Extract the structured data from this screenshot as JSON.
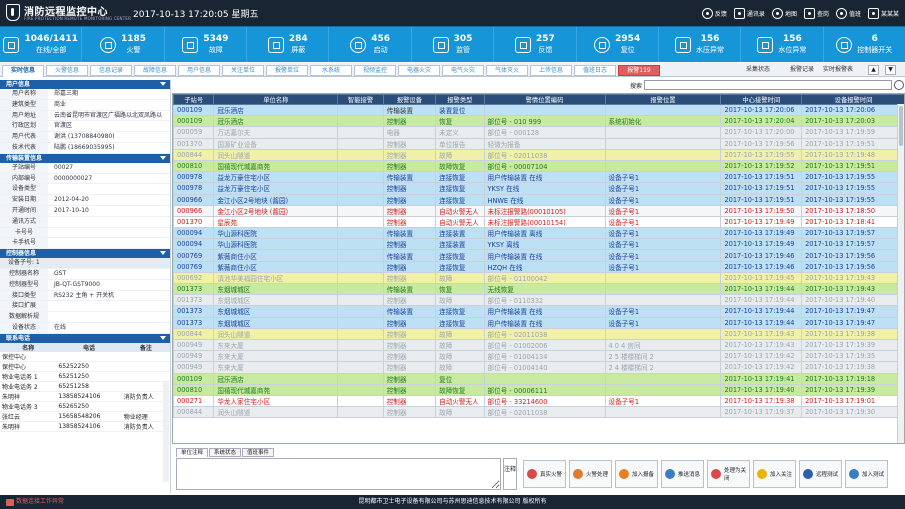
{
  "header": {
    "title": "消防远程监控中心",
    "subtitle": "FIRE PROTECTION REMOTE MONITORING CENTER",
    "datetime": "2017-10-13  17:20:05  星期五",
    "tools": [
      {
        "label": "反馈",
        "icon": "feedback-icon"
      },
      {
        "label": "通讯录",
        "icon": "contacts-icon"
      },
      {
        "label": "地图",
        "icon": "map-icon"
      },
      {
        "label": "查岗",
        "icon": "patrol-icon"
      },
      {
        "label": "值班",
        "icon": "duty-icon"
      },
      {
        "label": "某某某",
        "icon": "user-icon"
      }
    ]
  },
  "stats": [
    {
      "value": "1046/1411",
      "label": "在线/全部",
      "icon": "online-icon"
    },
    {
      "value": "1185",
      "label": "火警",
      "icon": "fire-alarm-icon"
    },
    {
      "value": "5349",
      "label": "故障",
      "icon": "fault-icon"
    },
    {
      "value": "284",
      "label": "屏蔽",
      "icon": "shield-icon"
    },
    {
      "value": "456",
      "label": "启动",
      "icon": "start-icon"
    },
    {
      "value": "305",
      "label": "监管",
      "icon": "supervise-icon"
    },
    {
      "value": "257",
      "label": "反馈",
      "icon": "feedback-stat-icon"
    },
    {
      "value": "2954",
      "label": "复位",
      "icon": "reset-icon"
    },
    {
      "value": "156",
      "label": "水压异常",
      "icon": "water-pressure-icon"
    },
    {
      "value": "156",
      "label": "水位异常",
      "icon": "water-level-icon"
    },
    {
      "value": "6",
      "label": "控制器开关",
      "icon": "controller-switch-icon"
    }
  ],
  "tabs": [
    "实时信息",
    "火警信息",
    "信息记录",
    "故障信息",
    "用户信息",
    "关注单位",
    "报警单位",
    "水系统",
    "视频监控",
    "电器火灾",
    "电气火灾",
    "气体灭火",
    "上传信息",
    "值班日志",
    "报警119"
  ],
  "tab_tools": {
    "collect": "采集状态",
    "report": "报警记录",
    "realtime": "实时报警表"
  },
  "user_info": {
    "title": "用户信息",
    "rows": [
      {
        "k": "用户名称",
        "v": "郑嘉三期"
      },
      {
        "k": "建筑类型",
        "v": "商业"
      },
      {
        "k": "用户地址",
        "v": "云南省昆明市官渡区广福路以北双凤路以"
      },
      {
        "k": "行政区划",
        "v": "官渡区"
      },
      {
        "k": "用户代表",
        "v": "谢洪 (13708840980)"
      },
      {
        "k": "技术代表",
        "v": "陆鹏 (18669035995)"
      }
    ]
  },
  "device_info": {
    "title": "传输装置信息",
    "rows": [
      {
        "k": "子站编号",
        "v": "00027"
      },
      {
        "k": "内部编号",
        "v": "0000000027"
      },
      {
        "k": "设备类型",
        "v": ""
      },
      {
        "k": "安装日期",
        "v": "2012-04-20"
      },
      {
        "k": "开通时间",
        "v": "2017-10-10"
      },
      {
        "k": "通讯方式",
        "v": ""
      },
      {
        "k": "卡号号",
        "v": ""
      },
      {
        "k": "卡手机号",
        "v": ""
      }
    ]
  },
  "controller_info": {
    "title": "控制器信息",
    "sub": "设备子号: 1",
    "rows": [
      {
        "k": "控制器名称",
        "v": "GST"
      },
      {
        "k": "控制器型号",
        "v": "JB-QT-GST9000"
      },
      {
        "k": "接口类型",
        "v": "RS232 主角 + 开关机"
      },
      {
        "k": "接口扩展",
        "v": ""
      },
      {
        "k": "数据解析规",
        "v": ""
      },
      {
        "k": "设备状态",
        "v": "在线"
      }
    ]
  },
  "contacts": {
    "title": "联系电话",
    "headers": [
      "名称",
      "电话",
      "备注"
    ],
    "rows": [
      [
        "保控中心",
        "",
        ""
      ],
      [
        "保控中心",
        "65252250",
        ""
      ],
      [
        "物业电话务 1",
        "65251250",
        ""
      ],
      [
        "物业电话务 2",
        "65251258",
        ""
      ],
      [
        "朱明祥",
        "13858524106",
        "消防负责人"
      ],
      [
        "物业电话务 3",
        "65265250",
        ""
      ],
      [
        "张红云",
        "15658548206",
        "物业经理"
      ],
      [
        "朱明祥",
        "13858524106",
        "消防负责人"
      ]
    ]
  },
  "search": {
    "label": "搜索",
    "placeholder": ""
  },
  "table": {
    "headers": [
      "子站号",
      "单位名称",
      "智能接警",
      "报警设备",
      "报警类型",
      "警情位置编码",
      "报警位置",
      "中心接警时间",
      "设备报警时间"
    ],
    "rows": [
      {
        "s": "bl",
        "c": [
          "c-b",
          "c-b",
          "c-gy",
          "c-k",
          "c-b",
          "c-b",
          "c-b",
          "c-b",
          "c-b"
        ],
        "v": [
          "000109",
          "冠乐酒店",
          "",
          "传输装置",
          "装置复位",
          "",
          "",
          "2017-10-13 17:20:06",
          "2017-10-13 17:20:06"
        ]
      },
      {
        "s": "gr",
        "c": [
          "c-g",
          "c-g",
          "c-gy",
          "c-g",
          "c-g",
          "c-g",
          "c-g",
          "c-g",
          "c-g"
        ],
        "v": [
          "000109",
          "冠乐酒店",
          "",
          "控制器",
          "恢复",
          "部位号 - 010 999",
          "系统初始化",
          "2017-10-13 17:20:04",
          "2017-10-13 17:20:03"
        ]
      },
      {
        "s": "gy",
        "c": [
          "c-gy",
          "c-gy",
          "c-gy",
          "c-gy",
          "c-gy",
          "c-gy",
          "c-gy",
          "c-gy",
          "c-gy"
        ],
        "v": [
          "000059",
          "万达嘉尔夫",
          "",
          "电器",
          "未定义",
          "部位号 - 000128",
          "",
          "2017-10-13 17:20:00",
          "2017-10-13 17:19:59"
        ]
      },
      {
        "s": "gy",
        "c": [
          "c-gy",
          "c-gy",
          "c-gy",
          "c-gy",
          "c-gy",
          "c-gy",
          "c-gy",
          "c-gy",
          "c-gy"
        ],
        "v": [
          "001370",
          "国源矿业设备",
          "",
          "控制器",
          "单位报告",
          "轻微为报备",
          "",
          "2017-10-13 17:19:56",
          "2017-10-13 17:19:51"
        ]
      },
      {
        "s": "yl",
        "c": [
          "c-gy",
          "c-gy",
          "c-gy",
          "c-gy",
          "c-gy",
          "c-gy",
          "c-gy",
          "c-gy",
          "c-gy"
        ],
        "v": [
          "000844",
          "润头山隧道",
          "",
          "控制器",
          "故障",
          "部位号 - 02011038",
          "",
          "2017-10-13 17:19:55",
          "2017-10-13 17:19:48"
        ]
      },
      {
        "s": "gr",
        "c": [
          "c-g",
          "c-g",
          "c-gy",
          "c-g",
          "c-g",
          "c-g",
          "c-g",
          "c-g",
          "c-g"
        ],
        "v": [
          "000810",
          "国禧现代城嘉商苑",
          "",
          "控制器",
          "故障恢复",
          "部位号 - 00007104",
          "",
          "2017-10-13 17:19:52",
          "2017-10-13 17:19:51"
        ]
      },
      {
        "s": "bl",
        "c": [
          "c-b",
          "c-b",
          "c-gy",
          "c-b",
          "c-b",
          "c-b",
          "c-b",
          "c-b",
          "c-b"
        ],
        "v": [
          "000978",
          "益龙万豪住宅小区",
          "",
          "传输装置",
          "连接恢复",
          "用户传输装置 在线",
          "设备子号1",
          "2017-10-13 17:19:51",
          "2017-10-13 17:19:55"
        ]
      },
      {
        "s": "bl",
        "c": [
          "c-b",
          "c-b",
          "c-gy",
          "c-b",
          "c-b",
          "c-b",
          "c-b",
          "c-b",
          "c-b"
        ],
        "v": [
          "000978",
          "益龙万豪住宅小区",
          "",
          "控制器",
          "连接恢复",
          "YKSY 在线",
          "设备子号1",
          "2017-10-13 17:19:51",
          "2017-10-13 17:19:55"
        ]
      },
      {
        "s": "bl",
        "c": [
          "c-b",
          "c-b",
          "c-gy",
          "c-b",
          "c-b",
          "c-b",
          "c-b",
          "c-b",
          "c-b"
        ],
        "v": [
          "000966",
          "金江小区2号地块 (酱园)",
          "",
          "控制器",
          "连接恢复",
          "HNWE 在线",
          "设备子号1",
          "2017-10-13 17:19:51",
          "2017-10-13 17:19:55"
        ]
      },
      {
        "s": "",
        "c": [
          "c-r",
          "c-r",
          "c-gy",
          "c-r",
          "c-r",
          "c-r",
          "c-r",
          "c-r",
          "c-r"
        ],
        "v": [
          "000966",
          "金江小区2号地块 (酱园)",
          "",
          "控制器",
          "自动火警无人",
          "未标注报警路(00010105)",
          "设备子号1",
          "2017-10-13 17:19:50",
          "2017-10-13 17:18:50"
        ]
      },
      {
        "s": "",
        "c": [
          "c-r",
          "c-r",
          "c-gy",
          "c-r",
          "c-r",
          "c-r",
          "c-r",
          "c-r",
          "c-r"
        ],
        "v": [
          "001370",
          "星辰苑",
          "",
          "控制器",
          "自动火警无人",
          "未标注报警路(00010154)",
          "设备子号1",
          "2017-10-13 17:19:49",
          "2017-10-13 17:18:41"
        ]
      },
      {
        "s": "bl",
        "c": [
          "c-b",
          "c-b",
          "c-gy",
          "c-b",
          "c-b",
          "c-b",
          "c-b",
          "c-b",
          "c-b"
        ],
        "v": [
          "000094",
          "华山源科医院",
          "",
          "传输装置",
          "连接装置",
          "用户传输装置 离线",
          "设备子号1",
          "2017-10-13 17:19:49",
          "2017-10-13 17:19:57"
        ]
      },
      {
        "s": "bl",
        "c": [
          "c-b",
          "c-b",
          "c-gy",
          "c-b",
          "c-b",
          "c-b",
          "c-b",
          "c-b",
          "c-b"
        ],
        "v": [
          "000094",
          "华山源科医院",
          "",
          "控制器",
          "连接装置",
          "YKSY 离线",
          "设备子号1",
          "2017-10-13 17:19:49",
          "2017-10-13 17:19:57"
        ]
      },
      {
        "s": "bl",
        "c": [
          "c-b",
          "c-b",
          "c-gy",
          "c-b",
          "c-b",
          "c-b",
          "c-b",
          "c-b",
          "c-b"
        ],
        "v": [
          "000769",
          "紫薇商住小区",
          "",
          "传输装置",
          "连接恢复",
          "用户传输装置 在线",
          "设备子号1",
          "2017-10-13 17:19:46",
          "2017-10-13 17:19:56"
        ]
      },
      {
        "s": "bl",
        "c": [
          "c-b",
          "c-b",
          "c-gy",
          "c-b",
          "c-b",
          "c-b",
          "c-b",
          "c-b",
          "c-b"
        ],
        "v": [
          "000769",
          "紫薇商住小区",
          "",
          "控制器",
          "连接恢复",
          "HZQH 在线",
          "设备子号1",
          "2017-10-13 17:19:46",
          "2017-10-13 17:19:56"
        ]
      },
      {
        "s": "yl",
        "c": [
          "c-gy",
          "c-gy",
          "c-gy",
          "c-gy",
          "c-gy",
          "c-gy",
          "c-gy",
          "c-gy",
          "c-gy"
        ],
        "v": [
          "000692",
          "滇池华美福园住宅小区",
          "",
          "控制器",
          "故障",
          "部位号 - 01100042",
          "",
          "2017-10-13 17:19:45",
          "2017-10-13 17:19:43"
        ]
      },
      {
        "s": "gr",
        "c": [
          "c-g",
          "c-g",
          "c-gy",
          "c-g",
          "c-g",
          "c-g",
          "c-g",
          "c-g",
          "c-g"
        ],
        "v": [
          "001373",
          "东烟城城区",
          "",
          "传输装置",
          "恢复",
          "无线恢复",
          "",
          "2017-10-13 17:19:44",
          "2017-10-13 17:19:43"
        ]
      },
      {
        "s": "gy",
        "c": [
          "c-gy",
          "c-gy",
          "c-gy",
          "c-gy",
          "c-gy",
          "c-gy",
          "c-gy",
          "c-gy",
          "c-gy"
        ],
        "v": [
          "001373",
          "东烟城城区",
          "",
          "控制器",
          "故障",
          "部位号 - 0110332",
          "",
          "2017-10-13 17:19:44",
          "2017-10-13 17:19:40"
        ]
      },
      {
        "s": "bl",
        "c": [
          "c-b",
          "c-b",
          "c-gy",
          "c-b",
          "c-b",
          "c-b",
          "c-b",
          "c-b",
          "c-b"
        ],
        "v": [
          "001373",
          "东烟城城区",
          "",
          "传输装置",
          "连接恢复",
          "用户传输装置 在线",
          "设备子号1",
          "2017-10-13 17:19:44",
          "2017-10-13 17:19:47"
        ]
      },
      {
        "s": "bl",
        "c": [
          "c-b",
          "c-b",
          "c-gy",
          "c-b",
          "c-b",
          "c-b",
          "c-b",
          "c-b",
          "c-b"
        ],
        "v": [
          "001373",
          "东烟城城区",
          "",
          "控制器",
          "连接恢复",
          "用户传输装置 在线",
          "设备子号1",
          "2017-10-13 17:19:44",
          "2017-10-13 17:19:47"
        ]
      },
      {
        "s": "yl",
        "c": [
          "c-gy",
          "c-gy",
          "c-gy",
          "c-gy",
          "c-gy",
          "c-gy",
          "c-gy",
          "c-gy",
          "c-gy"
        ],
        "v": [
          "000844",
          "润头山隧道",
          "",
          "控制器",
          "故障",
          "部位号 - 02011038",
          "",
          "2017-10-13 17:19:43",
          "2017-10-13 17:19:38"
        ]
      },
      {
        "s": "gy",
        "c": [
          "c-gy",
          "c-gy",
          "c-gy",
          "c-gy",
          "c-gy",
          "c-gy",
          "c-gy",
          "c-gy",
          "c-gy"
        ],
        "v": [
          "000949",
          "东来大厦",
          "",
          "控制器",
          "故障",
          "部位号 - 01002006",
          "4 0 4 房间",
          "2017-10-13 17:19:43",
          "2017-10-13 17:19:39"
        ]
      },
      {
        "s": "gy",
        "c": [
          "c-gy",
          "c-gy",
          "c-gy",
          "c-gy",
          "c-gy",
          "c-gy",
          "c-gy",
          "c-gy",
          "c-gy"
        ],
        "v": [
          "000949",
          "东来大厦",
          "",
          "控制器",
          "故障",
          "部位号 - 01004134",
          "2 5 楼楼梯间 2",
          "2017-10-13 17:19:42",
          "2017-10-13 17:19:35"
        ]
      },
      {
        "s": "gy",
        "c": [
          "c-gy",
          "c-gy",
          "c-gy",
          "c-gy",
          "c-gy",
          "c-gy",
          "c-gy",
          "c-gy",
          "c-gy"
        ],
        "v": [
          "000949",
          "东来大厦",
          "",
          "控制器",
          "故障",
          "部位号 - 01004140",
          "2 4 楼楼梯间 2",
          "2017-10-13 17:19:42",
          "2017-10-13 17:19:38"
        ]
      },
      {
        "s": "gr",
        "c": [
          "c-g",
          "c-g",
          "c-gy",
          "c-g",
          "c-g",
          "c-g",
          "c-g",
          "c-g",
          "c-g"
        ],
        "v": [
          "000109",
          "冠乐酒店",
          "",
          "控制器",
          "复位",
          "",
          "",
          "2017-10-13 17:19:41",
          "2017-10-13 17:19:18"
        ]
      },
      {
        "s": "gr",
        "c": [
          "c-g",
          "c-g",
          "c-gy",
          "c-g",
          "c-g",
          "c-g",
          "c-g",
          "c-g",
          "c-g"
        ],
        "v": [
          "000810",
          "国禧现代城嘉商苑",
          "",
          "控制器",
          "故障恢复",
          "部位号 - 00006111",
          "",
          "2017-10-13 17:19:40",
          "2017-10-13 17:19:39"
        ]
      },
      {
        "s": "",
        "c": [
          "c-r",
          "c-r",
          "c-gy",
          "c-r",
          "c-r",
          "c-r",
          "c-r",
          "c-r",
          "c-r"
        ],
        "v": [
          "000271",
          "华龙人家住宅小区",
          "",
          "控制器",
          "自动火警无人",
          "部位号 - 33214600",
          "设备子号1",
          "2017-10-13 17:19:38",
          "2017-10-13 17:19:01"
        ]
      },
      {
        "s": "gy",
        "c": [
          "c-gy",
          "c-gy",
          "c-gy",
          "c-gy",
          "c-gy",
          "c-gy",
          "c-gy",
          "c-gy",
          "c-gy"
        ],
        "v": [
          "000844",
          "润头山隧道",
          "",
          "控制器",
          "故障",
          "部位号 - 02011038",
          "",
          "2017-10-13 17:19:37",
          "2017-10-13 17:19:30"
        ]
      }
    ]
  },
  "bottom": {
    "tabs": [
      "单位注释",
      "系统状态",
      "值班事件"
    ],
    "note_button": "注释",
    "actions": [
      {
        "label": "真实火警",
        "color": "#d84a4a"
      },
      {
        "label": "火警处理",
        "color": "#e07a2e"
      },
      {
        "label": "加入报备",
        "color": "#e67e22"
      },
      {
        "label": "推送消息",
        "color": "#3b7dc4"
      },
      {
        "label": "处理为关闭",
        "color": "#d84a4a"
      },
      {
        "label": "加入关注",
        "color": "#f0b400"
      },
      {
        "label": "远程测试",
        "color": "#2b5fa8"
      },
      {
        "label": "加入测试",
        "color": "#3b7dc4"
      }
    ]
  },
  "footer": {
    "warning": "数据连接工作异常",
    "copyright": "昆明都市卫士电子设备有限公司与苏州思迪信息技术有限公司 版权所有"
  }
}
